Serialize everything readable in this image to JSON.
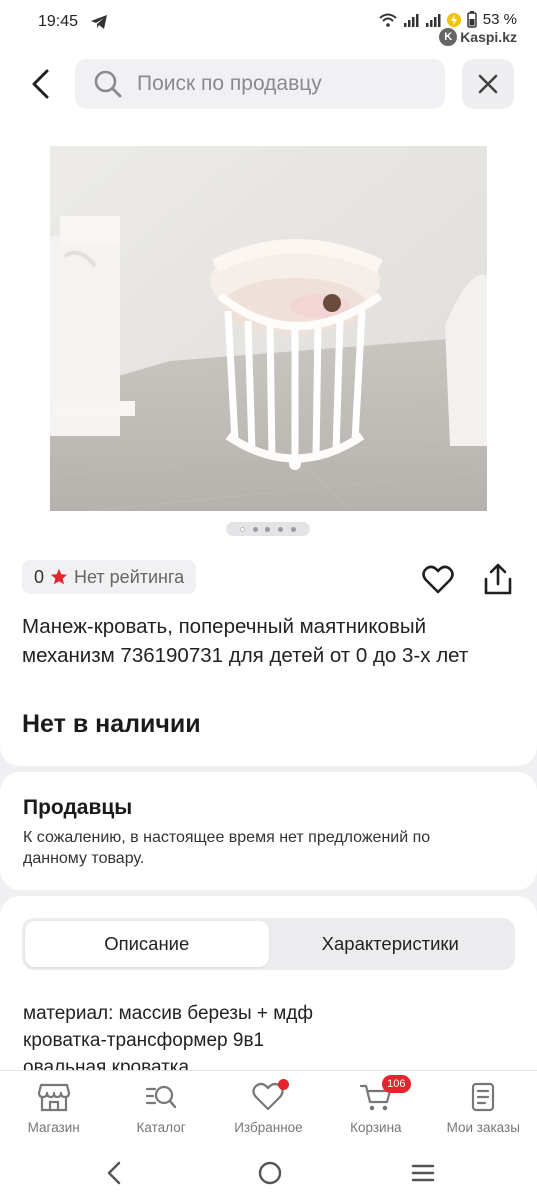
{
  "status_bar": {
    "time": "19:45",
    "battery": "53 %",
    "watermark": "Kaspi.kz"
  },
  "search": {
    "placeholder": "Поиск по продавцу"
  },
  "product": {
    "rating_value": "0",
    "rating_text": "Нет рейтинга",
    "title": "Манеж-кровать, поперечный маятниковый механизм 736190731 для детей от 0 до 3-х лет",
    "stock_status": "Нет в наличии",
    "gallery": {
      "count": 5,
      "active_index": 0
    }
  },
  "sellers": {
    "title": "Продавцы",
    "message": "К сожалению, в настоящее время нет предложений по данному товару."
  },
  "tabs": [
    {
      "label": "Описание",
      "active": true
    },
    {
      "label": "Характеристики",
      "active": false
    }
  ],
  "description": {
    "lines": [
      "материал: массив березы + мдф",
      "кроватка-трансформер 9в1",
      "овальная кроватка"
    ]
  },
  "bottom_nav": [
    {
      "label": "Магазин",
      "icon": "shop-icon"
    },
    {
      "label": "Каталог",
      "icon": "catalog-search-icon"
    },
    {
      "label": "Избранное",
      "icon": "heart-icon",
      "dot": true
    },
    {
      "label": "Корзина",
      "icon": "cart-icon",
      "badge": "106"
    },
    {
      "label": "Мои заказы",
      "icon": "orders-icon"
    }
  ],
  "colors": {
    "accent_red": "#e4252d",
    "background": "#f0f0f2",
    "card": "#ffffff"
  }
}
